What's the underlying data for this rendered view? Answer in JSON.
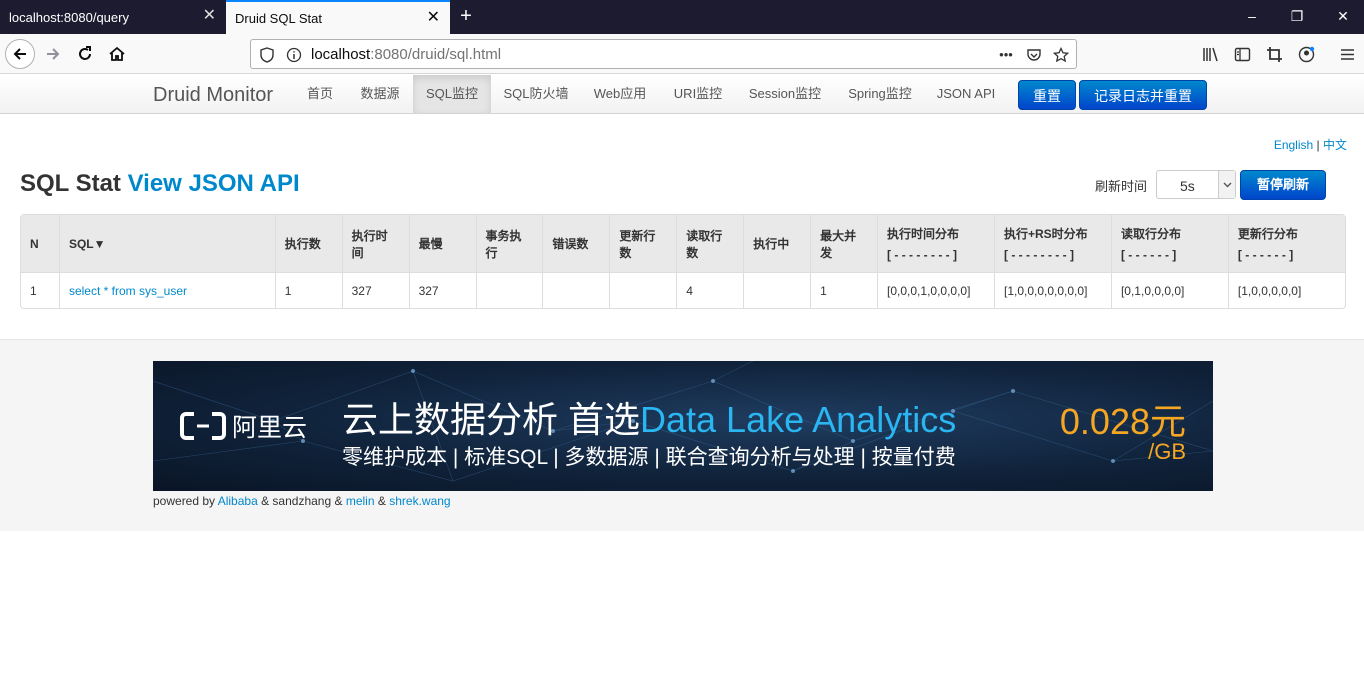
{
  "browser": {
    "tabs": [
      {
        "label": "localhost:8080/query",
        "close": "✕"
      },
      {
        "label": "Druid SQL Stat",
        "close": "✕"
      }
    ],
    "new_tab": "+",
    "window_controls": {
      "minimize": "–",
      "restore": "❐",
      "close": "✕"
    },
    "url_host": "localhost",
    "url_rest": ":8080/druid/sql.html",
    "url_more": "•••"
  },
  "druid_nav": {
    "brand": "Druid Monitor",
    "items": [
      "首页",
      "数据源",
      "SQL监控",
      "SQL防火墙",
      "Web应用",
      "URI监控",
      "Session监控",
      "Spring监控",
      "JSON API"
    ],
    "active": "SQL监控",
    "reset_button": "重置",
    "log_reset_button": "记录日志并重置"
  },
  "lang": {
    "english": "English",
    "sep": "|",
    "chinese": "中文"
  },
  "page": {
    "title": "SQL Stat",
    "json_link": "View JSON API",
    "refresh_label": "刷新时间",
    "refresh_value": "5s",
    "pause_button": "暂停刷新"
  },
  "table": {
    "headers": [
      {
        "line1": "N",
        "line2": ""
      },
      {
        "line1": "SQL▼",
        "line2": ""
      },
      {
        "line1": "执行数",
        "line2": ""
      },
      {
        "line1": "执行时间",
        "line2": ""
      },
      {
        "line1": "最慢",
        "line2": ""
      },
      {
        "line1": "事务执行",
        "line2": ""
      },
      {
        "line1": "错误数",
        "line2": ""
      },
      {
        "line1": "更新行数",
        "line2": ""
      },
      {
        "line1": "读取行数",
        "line2": ""
      },
      {
        "line1": "执行中",
        "line2": ""
      },
      {
        "line1": "最大并发",
        "line2": ""
      },
      {
        "line1": "执行时间分布",
        "line2": "[ - - - - - - - - ]"
      },
      {
        "line1": "执行+RS时分布",
        "line2": "[ - - - - - - - - ]"
      },
      {
        "line1": "读取行分布",
        "line2": "[ - - - - - - ]"
      },
      {
        "line1": "更新行分布",
        "line2": "[ - - - - - - ]"
      }
    ],
    "rows": [
      [
        "1",
        "select * from sys_user",
        "1",
        "327",
        "327",
        "",
        "",
        "",
        "4",
        "",
        "1",
        "[0,0,0,1,0,0,0,0]",
        "[1,0,0,0,0,0,0,0]",
        "[0,1,0,0,0,0]",
        "[1,0,0,0,0,0]"
      ]
    ]
  },
  "banner": {
    "logo_text": "阿里云",
    "headline_a": "云上数据分析 首选",
    "headline_b": "Data Lake Analytics",
    "subline": "零维护成本 | 标准SQL | 多数据源 | 联合查询分析与处理 | 按量付费",
    "price": "0.028元",
    "unit": "/GB"
  },
  "footer": {
    "powered_by": "powered by",
    "alibaba": "Alibaba",
    "amp1": "& sandzhang &",
    "melin": "melin",
    "amp2": "&",
    "shrek": "shrek.wang"
  },
  "colors": {
    "accent": "#0088cc",
    "titlebar": "#1c1b30",
    "price": "#f5a623",
    "banner_bg": "#10233b"
  }
}
